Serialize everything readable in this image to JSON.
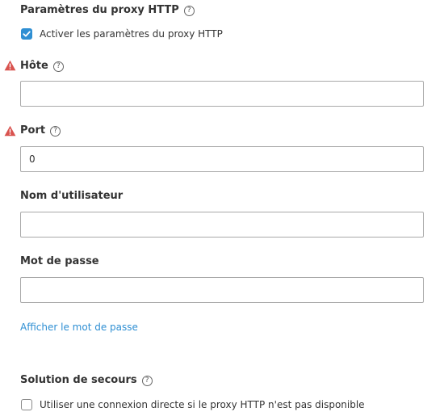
{
  "proxy_section": {
    "title": "Paramètres du proxy HTTP",
    "help_icon": "question-circle-icon",
    "enable_checkbox": {
      "label": "Activer les paramètres du proxy HTTP",
      "checked": true
    }
  },
  "fields": {
    "host": {
      "label": "Hôte",
      "value": "",
      "warning_icon": "warning-triangle-icon",
      "help_icon": "question-circle-icon"
    },
    "port": {
      "label": "Port",
      "value": "0",
      "warning_icon": "warning-triangle-icon",
      "help_icon": "question-circle-icon"
    },
    "username": {
      "label": "Nom d'utilisateur",
      "value": ""
    },
    "password": {
      "label": "Mot de passe",
      "value": ""
    }
  },
  "show_password_link": "Afficher le mot de passe",
  "fallback_section": {
    "title": "Solution de secours",
    "help_icon": "question-circle-icon",
    "direct_connection_checkbox": {
      "label": "Utiliser une connexion directe si le proxy HTTP n'est pas disponible",
      "checked": false
    }
  },
  "colors": {
    "accent": "#2f8fd3",
    "warning": "#d9534f",
    "text": "#333333",
    "border": "#a9a9a9"
  }
}
